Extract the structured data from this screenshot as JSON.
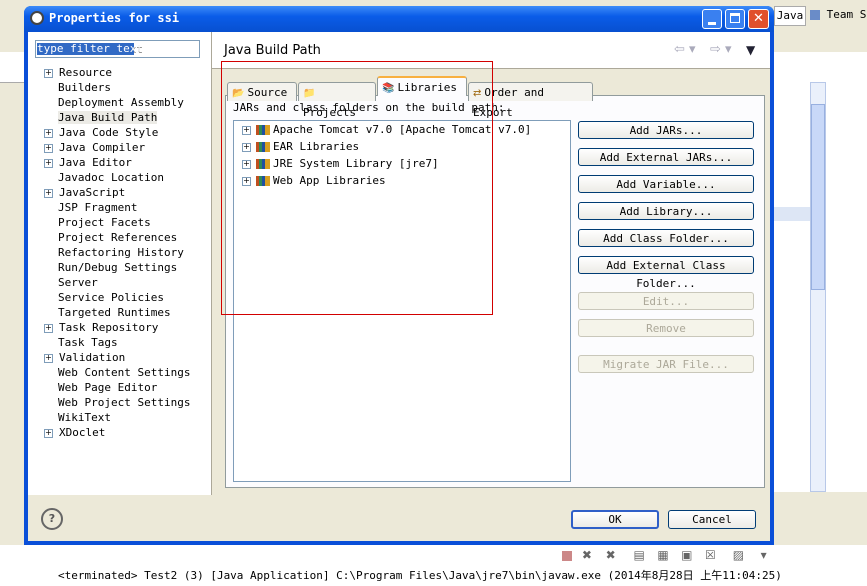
{
  "dialog": {
    "title": "Properties for ssi",
    "filter_placeholder": "type filter text",
    "page_title": "Java Build Path",
    "help_symbol": "?",
    "ok_label": "OK",
    "cancel_label": "Cancel"
  },
  "background": {
    "perspective_java": "Java",
    "perspective_team": "Team S",
    "console_status": "<terminated> Test2 (3) [Java Application] C:\\Program Files\\Java\\jre7\\bin\\javaw.exe (2014年8月28日 上午11:04:25)"
  },
  "nav": [
    {
      "label": "Resource",
      "expandable": true
    },
    {
      "label": "Builders",
      "expandable": false
    },
    {
      "label": "Deployment Assembly",
      "expandable": false
    },
    {
      "label": "Java Build Path",
      "expandable": false,
      "selected": true
    },
    {
      "label": "Java Code Style",
      "expandable": true
    },
    {
      "label": "Java Compiler",
      "expandable": true
    },
    {
      "label": "Java Editor",
      "expandable": true
    },
    {
      "label": "Javadoc Location",
      "expandable": false
    },
    {
      "label": "JavaScript",
      "expandable": true
    },
    {
      "label": "JSP Fragment",
      "expandable": false
    },
    {
      "label": "Project Facets",
      "expandable": false
    },
    {
      "label": "Project References",
      "expandable": false
    },
    {
      "label": "Refactoring History",
      "expandable": false
    },
    {
      "label": "Run/Debug Settings",
      "expandable": false
    },
    {
      "label": "Server",
      "expandable": false
    },
    {
      "label": "Service Policies",
      "expandable": false
    },
    {
      "label": "Targeted Runtimes",
      "expandable": false
    },
    {
      "label": "Task Repository",
      "expandable": true
    },
    {
      "label": "Task Tags",
      "expandable": false
    },
    {
      "label": "Validation",
      "expandable": true
    },
    {
      "label": "Web Content Settings",
      "expandable": false
    },
    {
      "label": "Web Page Editor",
      "expandable": false
    },
    {
      "label": "Web Project Settings",
      "expandable": false
    },
    {
      "label": "WikiText",
      "expandable": false
    },
    {
      "label": "XDoclet",
      "expandable": true
    }
  ],
  "tabs": [
    {
      "label": "Source"
    },
    {
      "label": "Projects"
    },
    {
      "label": "Libraries",
      "active": true
    },
    {
      "label": "Order and Export"
    }
  ],
  "libraries_heading": "JARs and class folders on the build path:",
  "libraries": [
    {
      "label": "Apache Tomcat v7.0 [Apache Tomcat v7.0]"
    },
    {
      "label": "EAR Libraries"
    },
    {
      "label": "JRE System Library [jre7]"
    },
    {
      "label": "Web App Libraries"
    }
  ],
  "buttons": [
    {
      "label": "Add JARs...",
      "enabled": true
    },
    {
      "label": "Add External JARs...",
      "enabled": true
    },
    {
      "label": "Add Variable...",
      "enabled": true
    },
    {
      "label": "Add Library...",
      "enabled": true
    },
    {
      "label": "Add Class Folder...",
      "enabled": true
    },
    {
      "label": "Add External Class Folder...",
      "enabled": true
    },
    {
      "label": "Edit...",
      "enabled": false
    },
    {
      "label": "Remove",
      "enabled": false
    },
    {
      "label": "Migrate JAR File...",
      "enabled": false
    }
  ],
  "colors": {
    "titlebar": "#0a5ce8",
    "highlight": "#d20000",
    "accent": "#316ac5"
  }
}
